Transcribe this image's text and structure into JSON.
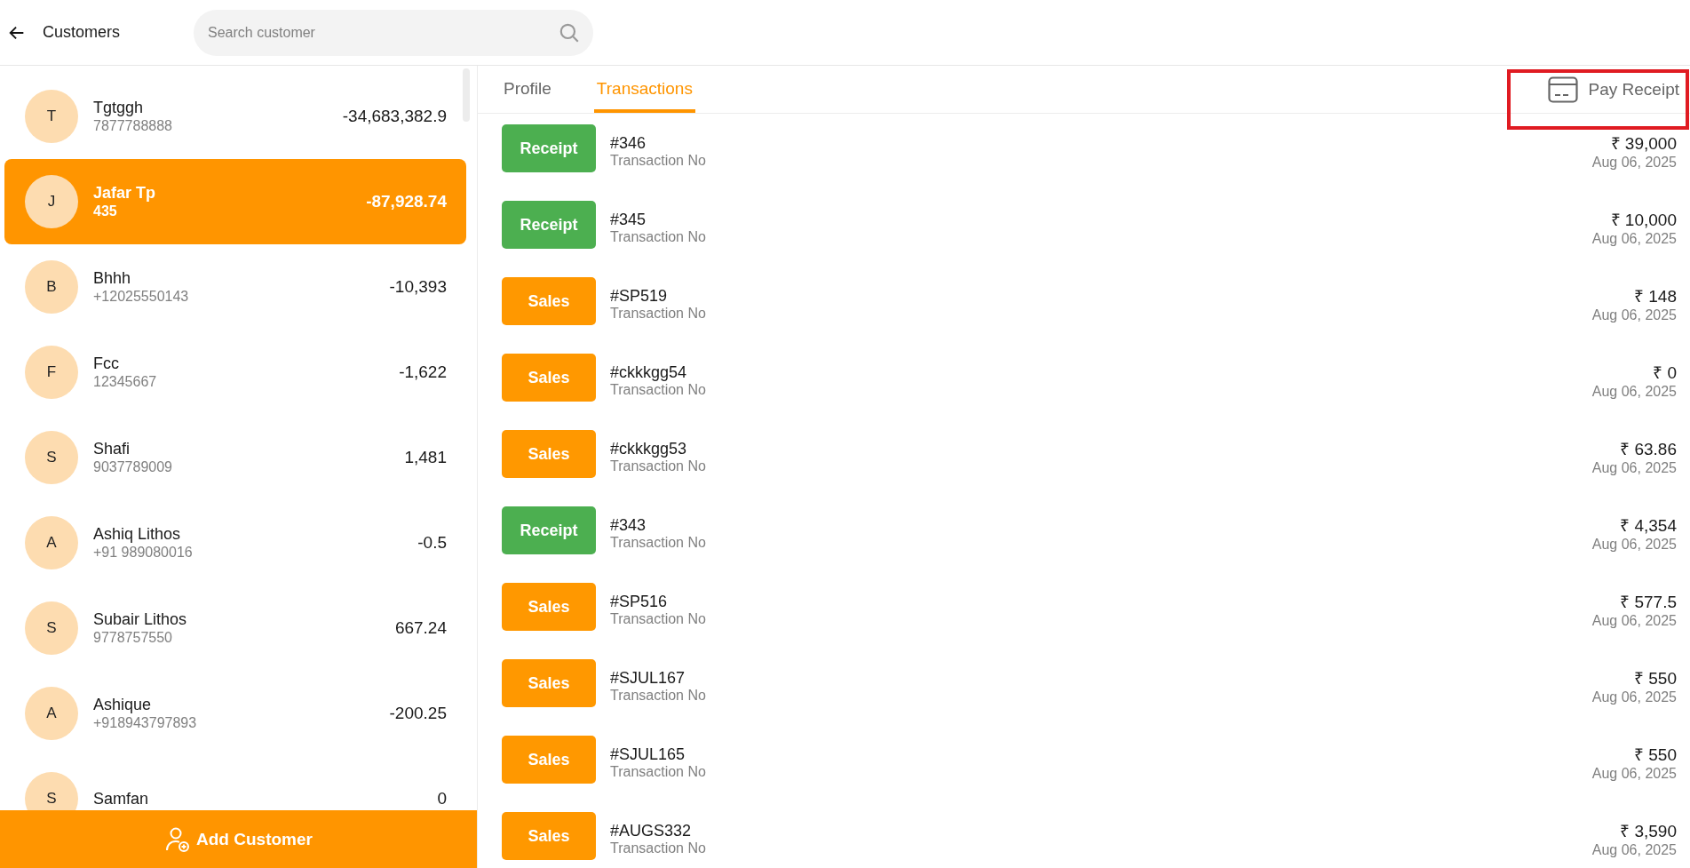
{
  "header": {
    "title": "Customers",
    "search": {
      "placeholder": "Search customer"
    }
  },
  "customers": [
    {
      "initial": "T",
      "name": "Tgtggh",
      "phone": "7877788888",
      "balance": "-34,683,382.9",
      "selected": false
    },
    {
      "initial": "J",
      "name": "Jafar Tp",
      "phone": "435",
      "balance": "-87,928.74",
      "selected": true
    },
    {
      "initial": "B",
      "name": "Bhhh",
      "phone": "+12025550143",
      "balance": "-10,393",
      "selected": false
    },
    {
      "initial": "F",
      "name": "Fcc",
      "phone": "12345667",
      "balance": "-1,622",
      "selected": false
    },
    {
      "initial": "S",
      "name": "Shafi",
      "phone": "9037789009",
      "balance": "1,481",
      "selected": false
    },
    {
      "initial": "A",
      "name": "Ashiq Lithos",
      "phone": "+91 989080016",
      "balance": "-0.5",
      "selected": false
    },
    {
      "initial": "S",
      "name": "Subair Lithos",
      "phone": "9778757550",
      "balance": "667.24",
      "selected": false
    },
    {
      "initial": "A",
      "name": "Ashique",
      "phone": "+918943797893",
      "balance": "-200.25",
      "selected": false
    },
    {
      "initial": "S",
      "name": "Samfan",
      "balance": "0",
      "selected": false
    }
  ],
  "add_customer": {
    "label": "Add Customer"
  },
  "tabs": [
    {
      "label": "Profile",
      "selected": false
    },
    {
      "label": "Transactions",
      "selected": true
    }
  ],
  "pay_receipt": {
    "label": "Pay Receipt"
  },
  "transactions": [
    {
      "kind": "receipt",
      "type": "Receipt",
      "number": "#346",
      "subtitle": "Transaction No",
      "amount": "₹ 39,000",
      "date": "Aug 06, 2025"
    },
    {
      "kind": "receipt",
      "type": "Receipt",
      "number": "#345",
      "subtitle": "Transaction No",
      "amount": "₹ 10,000",
      "date": "Aug 06, 2025"
    },
    {
      "kind": "sales",
      "type": "Sales",
      "number": "#SP519",
      "subtitle": "Transaction No",
      "amount": "₹ 148",
      "date": "Aug 06, 2025"
    },
    {
      "kind": "sales",
      "type": "Sales",
      "number": "#ckkkgg54",
      "subtitle": "Transaction No",
      "amount": "₹ 0",
      "date": "Aug 06, 2025"
    },
    {
      "kind": "sales",
      "type": "Sales",
      "number": "#ckkkgg53",
      "subtitle": "Transaction No",
      "amount": "₹ 63.86",
      "date": "Aug 06, 2025"
    },
    {
      "kind": "receipt",
      "type": "Receipt",
      "number": "#343",
      "subtitle": "Transaction No",
      "amount": "₹ 4,354",
      "date": "Aug 06, 2025"
    },
    {
      "kind": "sales",
      "type": "Sales",
      "number": "#SP516",
      "subtitle": "Transaction No",
      "amount": "₹ 577.5",
      "date": "Aug 06, 2025"
    },
    {
      "kind": "sales",
      "type": "Sales",
      "number": "#SJUL167",
      "subtitle": "Transaction No",
      "amount": "₹ 550",
      "date": "Aug 06, 2025"
    },
    {
      "kind": "sales",
      "type": "Sales",
      "number": "#SJUL165",
      "subtitle": "Transaction No",
      "amount": "₹ 550",
      "date": "Aug 06, 2025"
    },
    {
      "kind": "sales",
      "type": "Sales",
      "number": "#AUGS332",
      "subtitle": "Transaction No",
      "amount": "₹ 3,590",
      "date": "Aug 06, 2025"
    }
  ]
}
